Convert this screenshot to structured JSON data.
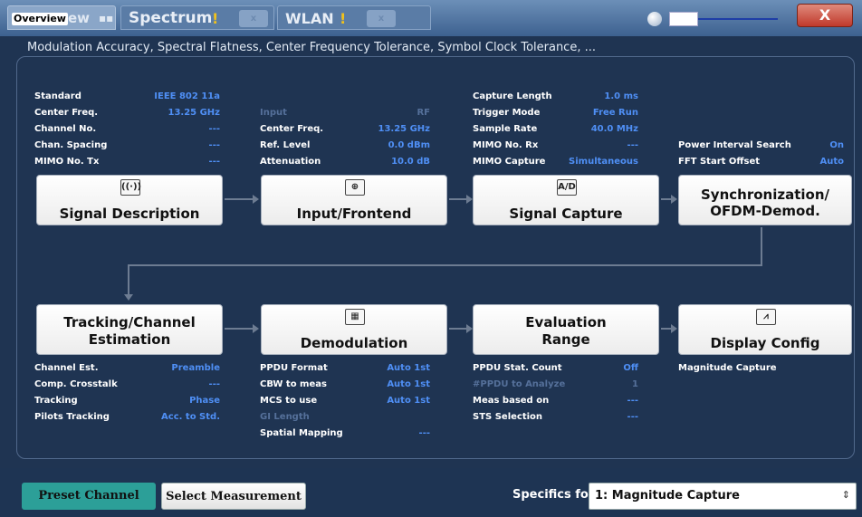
{
  "tabs": {
    "overview_label": "Overview",
    "overview_rest": "ew",
    "spectrum_label": "Spectrum",
    "wlan_label": "WLAN",
    "warn_glyph": "!",
    "close_glyph": "x"
  },
  "window": {
    "close_label": "X"
  },
  "subtitle": "Modulation Accuracy, Spectral Flatness, Center Frequency Tolerance, Symbol Clock Tolerance, ...",
  "params": {
    "standard_k": "Standard",
    "standard_v": "IEEE 802 11a",
    "cf1_k": "Center Freq.",
    "cf1_v": "13.25 GHz",
    "chno_k": "Channel No.",
    "chno_v": "---",
    "chsp_k": "Chan. Spacing",
    "chsp_v": "---",
    "mimotx_k": "MIMO No. Tx",
    "mimotx_v": "---",
    "input_k": "Input",
    "input_v": "RF",
    "cf2_k": "Center Freq.",
    "cf2_v": "13.25 GHz",
    "ref_k": "Ref. Level",
    "ref_v": "0.0 dBm",
    "att_k": "Attenuation",
    "att_v": "10.0 dB",
    "caplen_k": "Capture Length",
    "caplen_v": "1.0 ms",
    "trig_k": "Trigger Mode",
    "trig_v": "Free Run",
    "srate_k": "Sample Rate",
    "srate_v": "40.0 MHz",
    "mimorx_k": "MIMO No. Rx",
    "mimorx_v": "---",
    "mimocap_k": "MIMO Capture",
    "mimocap_v": "Simultaneous",
    "pis_k": "Power Interval Search",
    "pis_v": "On",
    "fft_k": "FFT Start Offset",
    "fft_v": "Auto",
    "chest_k": "Channel Est.",
    "chest_v": "Preamble",
    "xtalk_k": "Comp. Crosstalk",
    "xtalk_v": "---",
    "track_k": "Tracking",
    "track_v": "Phase",
    "pilot_k": "Pilots Tracking",
    "pilot_v": "Acc. to Std.",
    "ppdu_k": "PPDU Format",
    "ppdu_v": "Auto 1st",
    "cbw_k": "CBW to meas",
    "cbw_v": "Auto 1st",
    "mcs_k": "MCS to use",
    "mcs_v": "Auto 1st",
    "gi_k": "GI Length",
    "spatial_k": "Spatial Mapping",
    "spatial_v": "---",
    "stat_k": "PPDU Stat. Count",
    "stat_v": "Off",
    "nppdu_k": "#PPDU to Analyze",
    "nppdu_v": "1",
    "mbased_k": "Meas based on",
    "mbased_v": "---",
    "sts_k": "STS Selection",
    "sts_v": "---",
    "magcap_k": "Magnitude Capture"
  },
  "blocks": {
    "signal_description": {
      "icon": "wifi-icon",
      "title": "Signal Description"
    },
    "input_frontend": {
      "icon": "input-icon",
      "title": "Input/Frontend"
    },
    "signal_capture": {
      "icon": "ad-icon",
      "icon_text": "A/D",
      "title": "Signal Capture"
    },
    "sync": {
      "title_l1": "Synchronization/",
      "title_l2": "OFDM-Demod."
    },
    "tracking": {
      "title_l1": "Tracking/Channel",
      "title_l2": "Estimation"
    },
    "demod": {
      "icon": "grid-icon",
      "title": "Demodulation"
    },
    "eval": {
      "title_l1": "Evaluation",
      "title_l2": "Range"
    },
    "display": {
      "icon": "chart-icon",
      "title": "Display Config"
    }
  },
  "bottom": {
    "preset_label": "Preset Channel",
    "select_label": "Select Measurement",
    "specifics_label": "Specifics for",
    "specifics_value": "1: Magnitude Capture"
  }
}
